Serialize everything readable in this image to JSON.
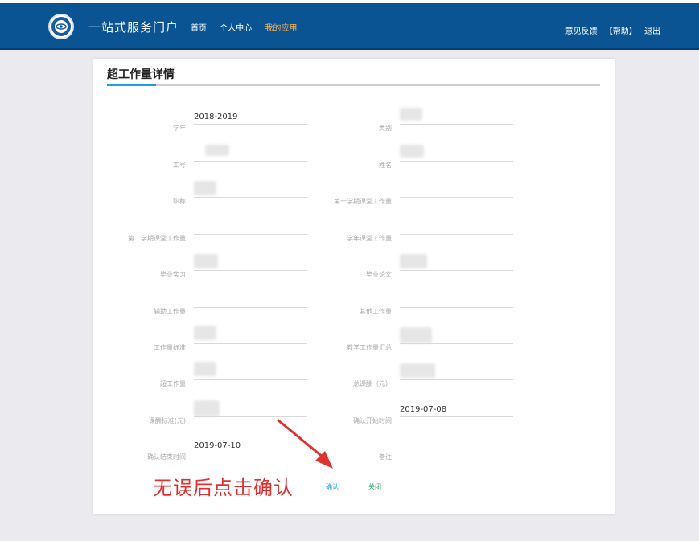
{
  "header": {
    "site_title": "一站式服务门户",
    "nav": [
      "首页",
      "个人中心",
      "我的应用"
    ],
    "active_nav": "我的应用",
    "right_links": [
      "意见反馈",
      "【帮助】",
      "退出"
    ],
    "brand_color": "#0a5493",
    "active_color": "#f3b460"
  },
  "card": {
    "title": "超工作量详情",
    "accent_color": "#1e9fde"
  },
  "form": {
    "left": [
      {
        "label": "学年",
        "value": "2018-2019"
      },
      {
        "label": "工号",
        "value": ""
      },
      {
        "label": "职称",
        "value": ""
      },
      {
        "label": "第二学期课堂工作量",
        "value": ""
      },
      {
        "label": "毕业实习",
        "value": ""
      },
      {
        "label": "辅助工作量",
        "value": ""
      },
      {
        "label": "工作量标准",
        "value": ""
      },
      {
        "label": "超工作量",
        "value": ""
      },
      {
        "label": "课酬标准(元)",
        "value": ""
      },
      {
        "label": "确认结束时间",
        "value": "2019-07-10"
      }
    ],
    "right": [
      {
        "label": "类别",
        "value": ""
      },
      {
        "label": "姓名",
        "value": ""
      },
      {
        "label": "第一学期课堂工作量",
        "value": ""
      },
      {
        "label": "学年课堂工作量",
        "value": ""
      },
      {
        "label": "毕业论文",
        "value": ""
      },
      {
        "label": "其他工作量",
        "value": ""
      },
      {
        "label": "教学工作量汇总",
        "value": ""
      },
      {
        "label": "总课酬（元）",
        "value": ""
      },
      {
        "label": "确认开始时间",
        "value": "2019-07-08"
      },
      {
        "label": "备注",
        "value": ""
      }
    ]
  },
  "actions": {
    "confirm_label": "确认",
    "close_label": "关闭"
  },
  "annotation": {
    "text": "无误后点击确认",
    "color": "#e03030"
  }
}
